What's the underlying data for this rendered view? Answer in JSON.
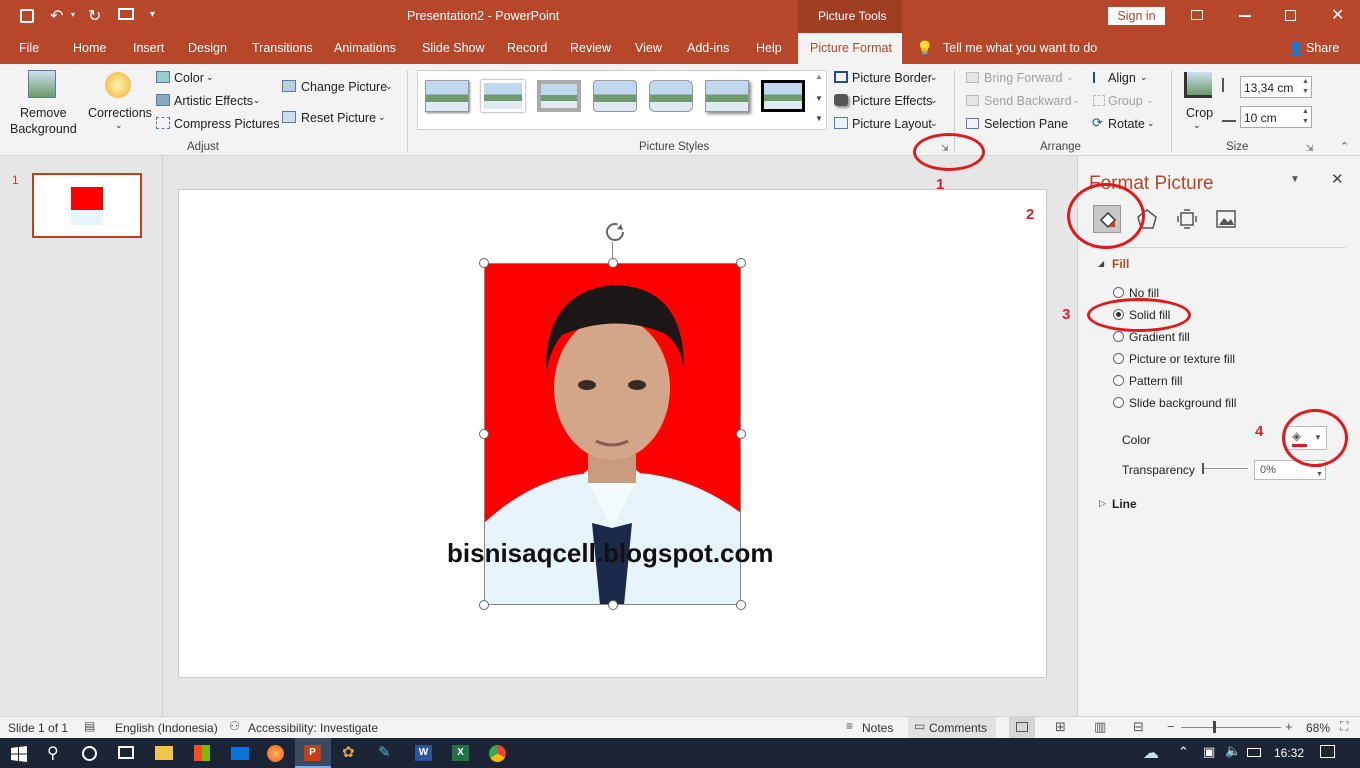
{
  "titlebar": {
    "title": "Presentation2 - PowerPoint",
    "context_tab": "Picture Tools",
    "sign_in": "Sign in"
  },
  "tabs": [
    "File",
    "Home",
    "Insert",
    "Design",
    "Transitions",
    "Animations",
    "Slide Show",
    "Record",
    "Review",
    "View",
    "Add-ins",
    "Help",
    "Picture Format"
  ],
  "tell_me": "Tell me what you want to do",
  "share": "Share",
  "ribbon": {
    "remove_bg_1": "Remove",
    "remove_bg_2": "Background",
    "corrections": "Corrections",
    "color": "Color",
    "artistic": "Artistic Effects",
    "compress": "Compress Pictures",
    "change_picture": "Change Picture",
    "reset_picture": "Reset Picture",
    "adjust_label": "Adjust",
    "styles_label": "Picture Styles",
    "picture_border": "Picture Border",
    "picture_effects": "Picture Effects",
    "picture_layout": "Picture Layout",
    "bring_forward": "Bring Forward",
    "send_backward": "Send Backward",
    "selection_pane": "Selection Pane",
    "align": "Align",
    "group": "Group",
    "rotate": "Rotate",
    "arrange_label": "Arrange",
    "crop": "Crop",
    "height": "13,34 cm",
    "width": "10 cm",
    "size_label": "Size"
  },
  "slides": {
    "number": "1"
  },
  "slide": {
    "watermark": "bisnisaqcell.blogspot.com"
  },
  "pane": {
    "title": "Format Picture",
    "fill_header": "Fill",
    "options": [
      "No fill",
      "Solid fill",
      "Gradient fill",
      "Picture or texture fill",
      "Pattern fill",
      "Slide background fill"
    ],
    "selected": "Solid fill",
    "color_label": "Color",
    "transparency_label": "Transparency",
    "transparency_value": "0%",
    "line_header": "Line"
  },
  "annotations": [
    "1",
    "2",
    "3",
    "4"
  ],
  "status": {
    "slide": "Slide 1 of 1",
    "language": "English (Indonesia)",
    "accessibility": "Accessibility: Investigate",
    "notes": "Notes",
    "comments": "Comments",
    "zoom": "68%"
  },
  "taskbar": {
    "time": "16:32"
  },
  "colors": {
    "accent": "#b7472a",
    "annotation": "#e0191e",
    "photo_bg": "#ff0000"
  }
}
